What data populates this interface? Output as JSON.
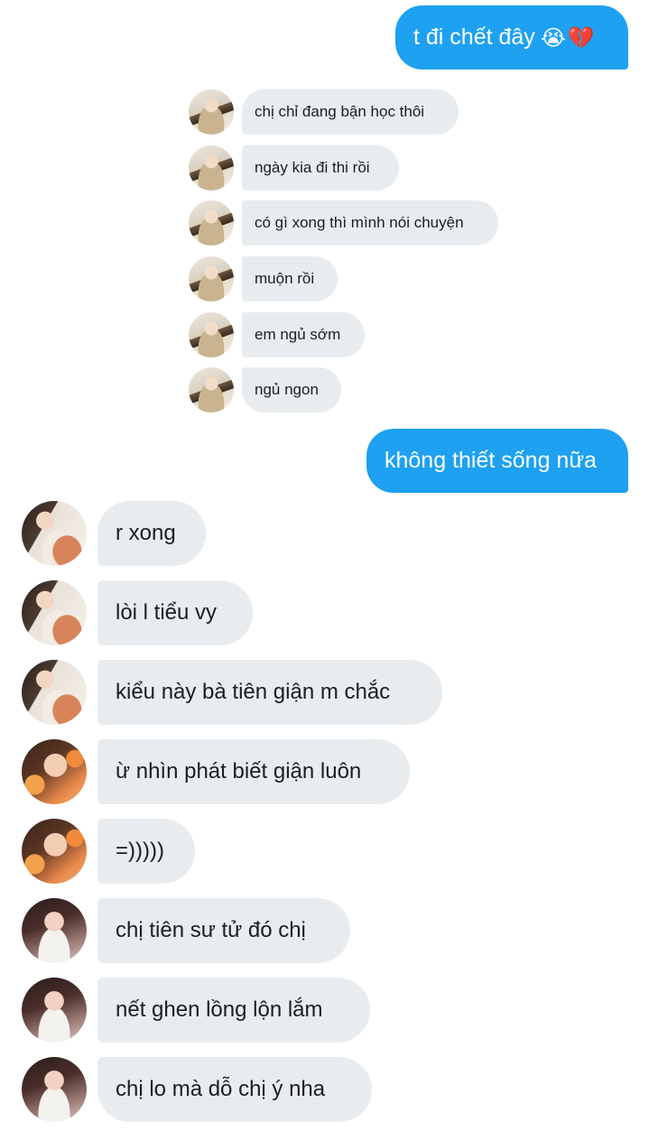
{
  "conversation": {
    "messages": [
      {
        "dir": "out",
        "text": "t đi chết đây",
        "emoji": "😭💔"
      },
      {
        "dir": "in",
        "text": "chị chỉ đang bận học thôi"
      },
      {
        "dir": "in",
        "text": "ngày kia đi thi rồi"
      },
      {
        "dir": "in",
        "text": "có gì xong thì mình nói chuyện"
      },
      {
        "dir": "in",
        "text": "muộn rồi"
      },
      {
        "dir": "in",
        "text": "em ngủ sớm"
      },
      {
        "dir": "in",
        "text": "ngủ ngon"
      },
      {
        "dir": "out",
        "text": "không thiết sống nữa"
      },
      {
        "dir": "in",
        "text": "r xong"
      },
      {
        "dir": "in",
        "text": "lòi l tiểu vy"
      },
      {
        "dir": "in",
        "text": "kiểu này bà tiên giận m chắc"
      },
      {
        "dir": "in",
        "text": "ừ nhìn phát biết giận luôn"
      },
      {
        "dir": "in",
        "text": "=)))))"
      },
      {
        "dir": "in",
        "text": "chị tiên sư tử đó chị"
      },
      {
        "dir": "in",
        "text": "nết ghen lồng lộn lắm"
      },
      {
        "dir": "in",
        "text": "chị lo mà dỗ chị ý nha"
      }
    ]
  },
  "colors": {
    "outgoing_bubble": "#1ea1f1",
    "incoming_bubble": "#e8ecef",
    "background": "#ffffff"
  }
}
